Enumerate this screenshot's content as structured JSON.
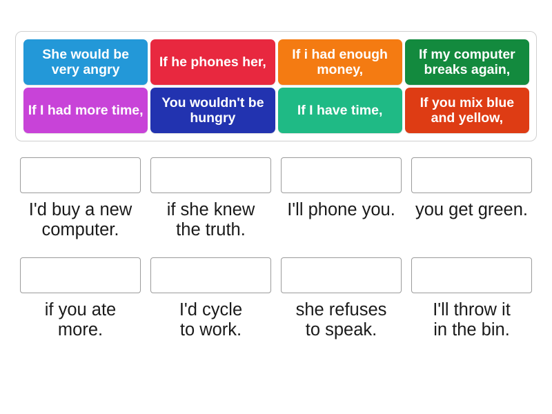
{
  "activity": {
    "type": "match-up-drag-and-drop",
    "tray": {
      "tiles": [
        {
          "text": "She would be\nvery angry",
          "color": "#2398D8"
        },
        {
          "text": "If he\nphones her,",
          "color": "#E8283F"
        },
        {
          "text": "If i had enough\nmoney,",
          "color": "#F47B12"
        },
        {
          "text": "If my computer\nbreaks again,",
          "color": "#138A3E"
        },
        {
          "text": "If I had\nmore time,",
          "color": "#C843D8"
        },
        {
          "text": "You wouldn't\nbe hungry",
          "color": "#2233B0"
        },
        {
          "text": "If I have time,",
          "color": "#1FBA85"
        },
        {
          "text": "If you mix blue\nand yellow,",
          "color": "#DE3C14"
        }
      ]
    },
    "answers": [
      {
        "dropped_value": "",
        "label": "I'd buy a new\ncomputer."
      },
      {
        "dropped_value": "",
        "label": "if she knew\nthe truth."
      },
      {
        "dropped_value": "",
        "label": "I'll phone you."
      },
      {
        "dropped_value": "",
        "label": "you get green."
      },
      {
        "dropped_value": "",
        "label": "if you ate\nmore."
      },
      {
        "dropped_value": "",
        "label": "I'd cycle\nto work."
      },
      {
        "dropped_value": "",
        "label": "she refuses\nto speak."
      },
      {
        "dropped_value": "",
        "label": "I'll throw it\nin the bin."
      }
    ]
  }
}
